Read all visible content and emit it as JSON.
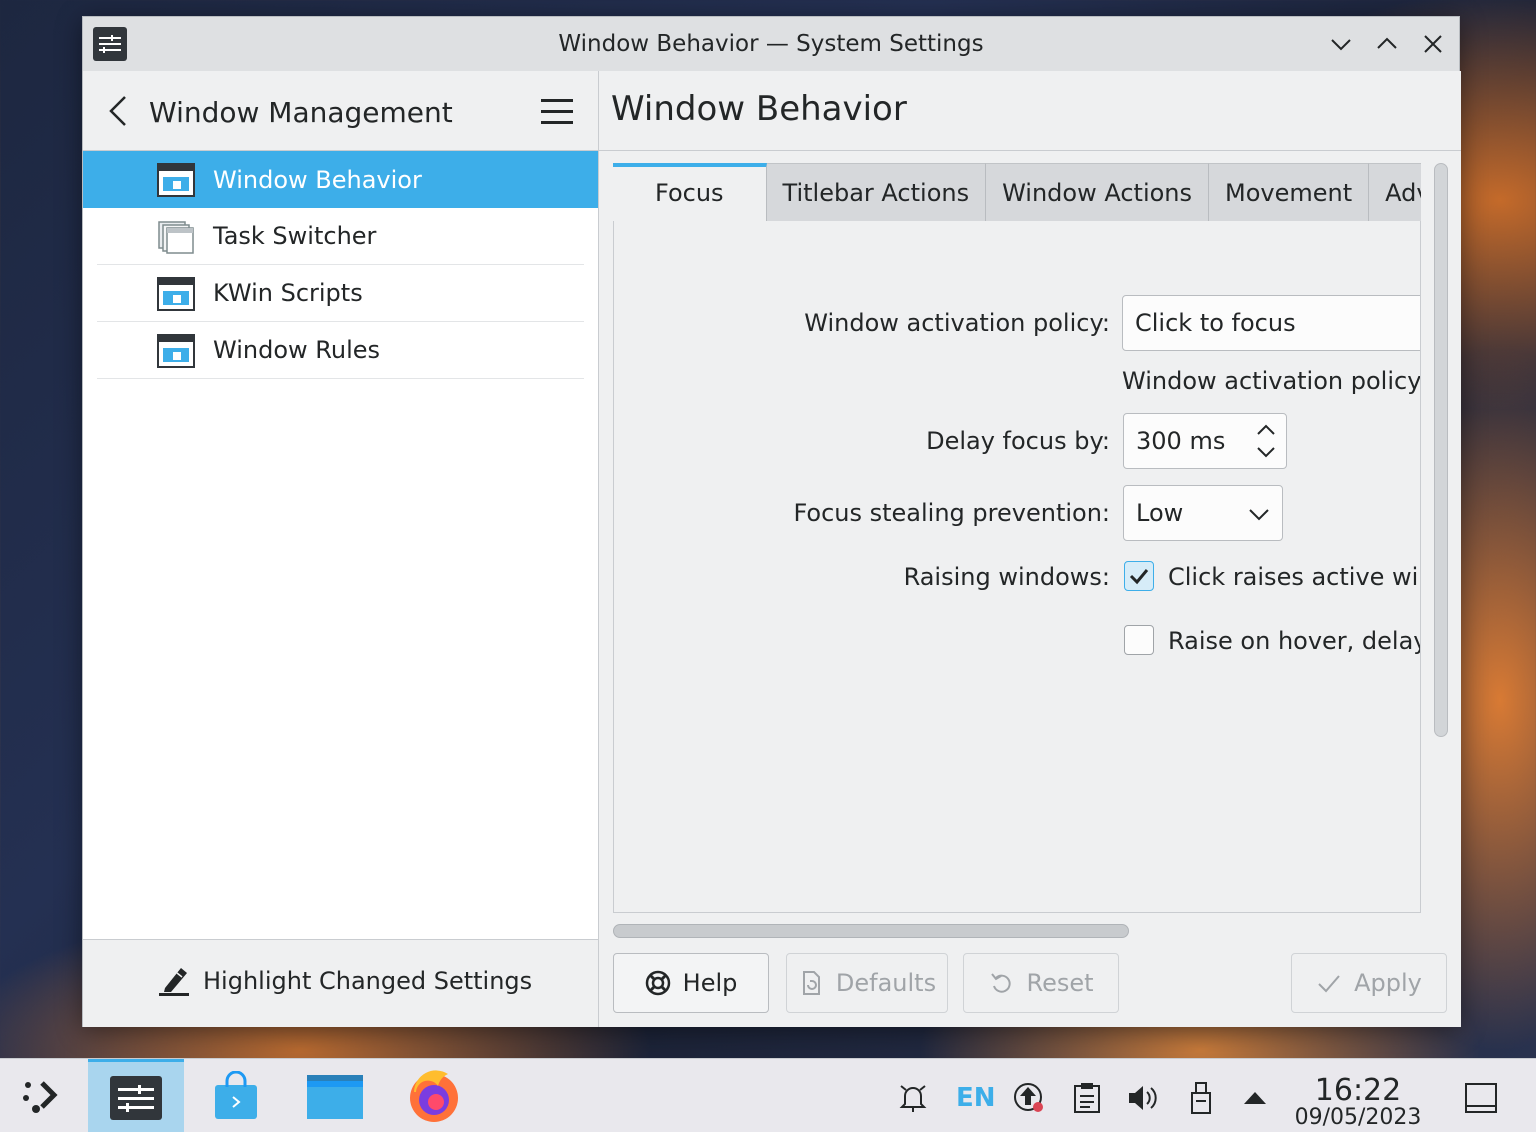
{
  "window": {
    "title": "Window Behavior — System Settings"
  },
  "sidebar": {
    "title": "Window Management",
    "items": [
      {
        "label": "Window Behavior",
        "active": true
      },
      {
        "label": "Task Switcher",
        "active": false
      },
      {
        "label": "KWin Scripts",
        "active": false
      },
      {
        "label": "Window Rules",
        "active": false
      }
    ],
    "footer_label": "Highlight Changed Settings"
  },
  "content": {
    "title": "Window Behavior",
    "tabs": [
      "Focus",
      "Titlebar Actions",
      "Window Actions",
      "Movement",
      "Adva"
    ],
    "active_tab": "Focus",
    "form": {
      "activation_policy_label": "Window activation policy:",
      "activation_policy_value": "Click to focus",
      "activation_policy_note": "Window activation policy d",
      "delay_focus_label": "Delay focus by:",
      "delay_focus_value": "300 ms",
      "focus_stealing_label": "Focus stealing prevention:",
      "focus_stealing_value": "Low",
      "raising_label": "Raising windows:",
      "click_raises_label": "Click raises active wind",
      "click_raises_checked": true,
      "raise_hover_label": "Raise on hover, delaye",
      "raise_hover_checked": false
    },
    "buttons": {
      "help": "Help",
      "defaults": "Defaults",
      "reset": "Reset",
      "apply": "Apply"
    }
  },
  "taskbar": {
    "language": "EN",
    "time": "16:22",
    "date": "09/05/2023"
  },
  "colors": {
    "accent": "#3daee9",
    "window_bg": "#eff0f1",
    "text": "#232627"
  }
}
